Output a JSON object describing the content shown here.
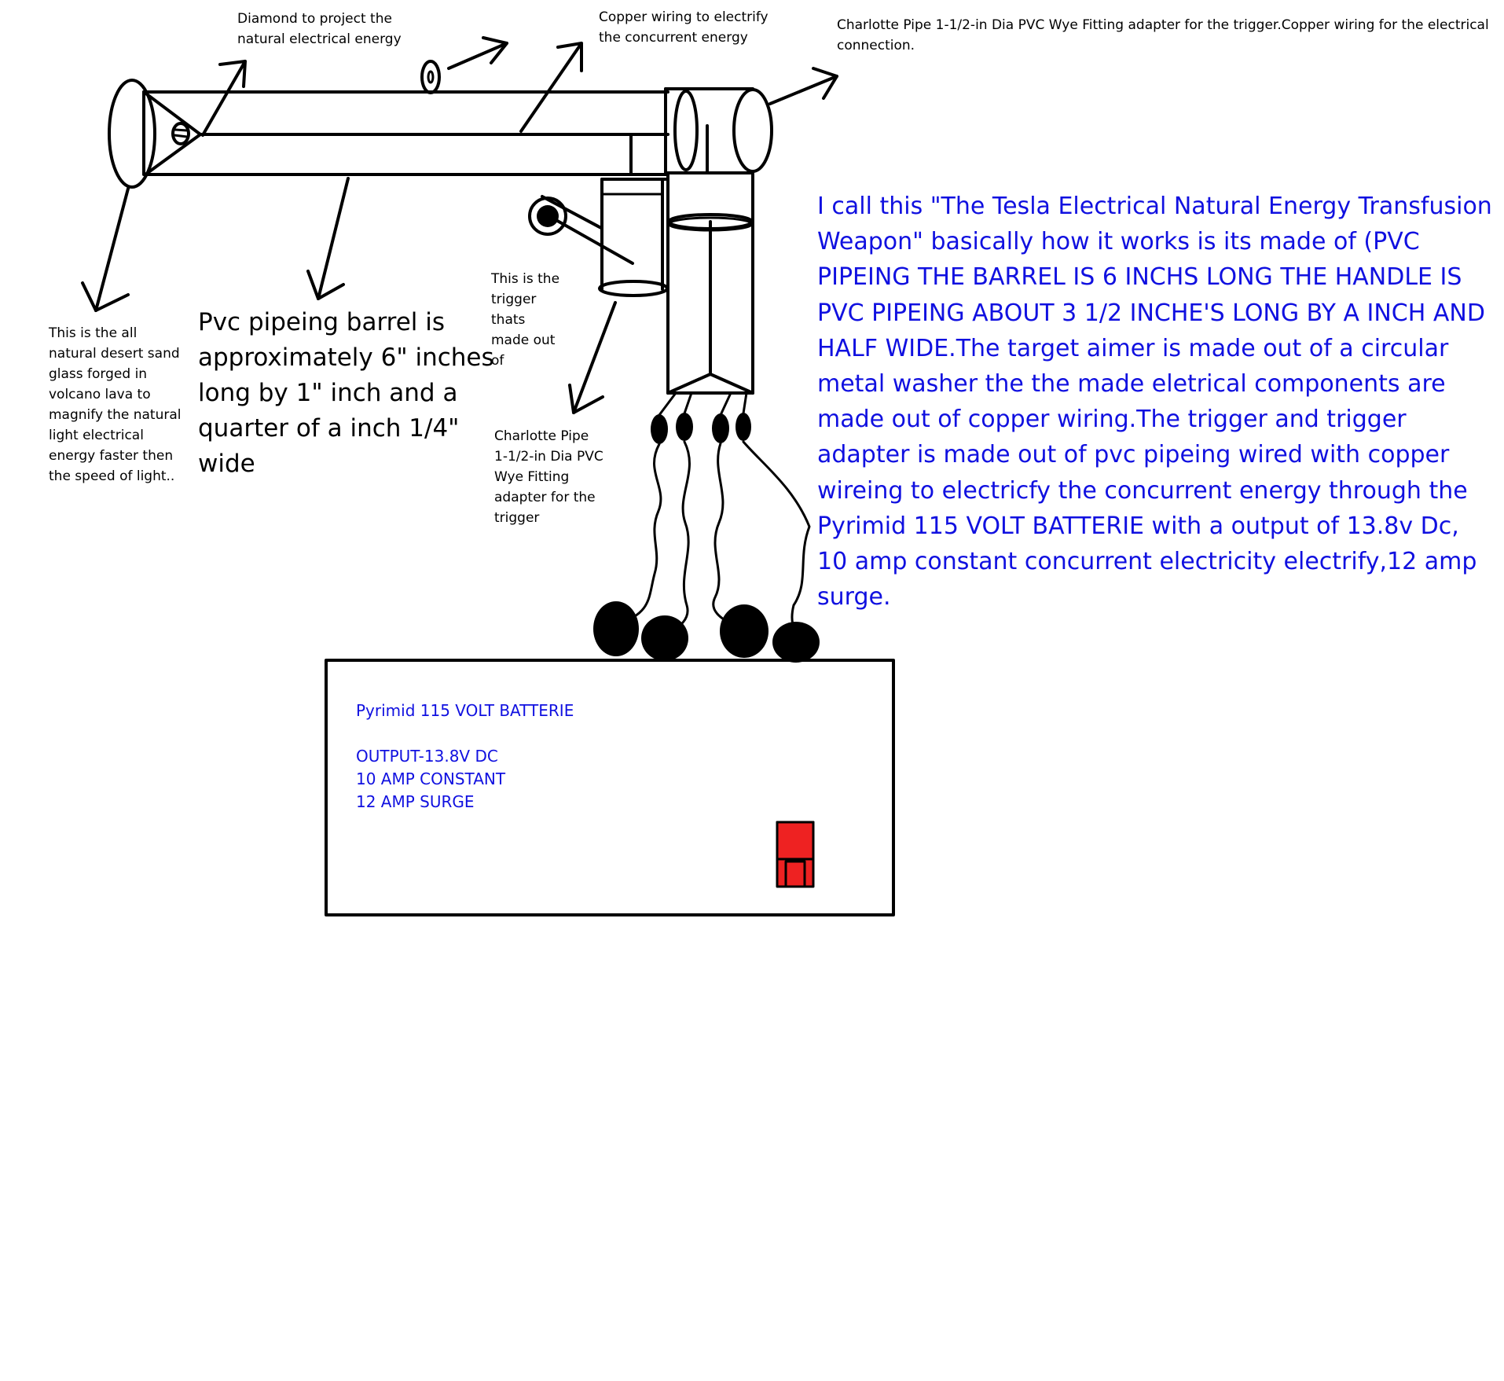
{
  "labels": {
    "diamond": "Diamond to project the\nnatural electrical energy",
    "copper_wiring": "Copper wiring to electrify\nthe concurrent energy",
    "wye_top": "Charlotte Pipe 1-1/2-in Dia PVC Wye Fitting adapter for the trigger.Copper wiring for the electrical\nconnection.",
    "sand_glass": "This is the all\nnatural desert sand\nglass forged in\nvolcano lava to\nmagnify the natural\nlight electrical\nenergy faster then\nthe speed of light..",
    "barrel": "Pvc pipeing barrel is\napproximately 6\" inches\nlong by 1\" inch and a\nquarter of a inch 1/4\"\nwide",
    "trigger": "This is the\ntrigger\nthats\nmade out\nof",
    "wye_trigger": "Charlotte Pipe\n1-1/2-in Dia PVC\nWye Fitting\nadapter for the\ntrigger"
  },
  "description": "I call this \"The Tesla Electrical Natural Energy Transfusion\nWeapon\" basically how it works is its made of (PVC\nPIPEING THE BARREL IS 6 INCHS LONG THE HANDLE IS\nPVC PIPEING ABOUT 3 1/2 INCHE'S LONG BY A INCH AND\nHALF WIDE.The target aimer is made out of a circular\nmetal washer the the made eletrical components are\nmade out of copper wiring.The trigger and trigger\nadapter is made out of pvc pipeing wired with copper\nwireing to electricfy the concurrent energy through the\nPyrimid 115 VOLT BATTERIE with a output of 13.8v Dc,\n10 amp constant concurrent electricity electrify,12 amp\nsurge.",
  "battery": {
    "title": "Pyrimid 115 VOLT BATTERIE",
    "output": "OUTPUT-13.8V DC",
    "constant": "10 AMP CONSTANT",
    "surge": "12 AMP SURGE"
  },
  "colors": {
    "ink": "#000000",
    "blue_text": "#1010e0",
    "switch_red": "#ee2222"
  }
}
